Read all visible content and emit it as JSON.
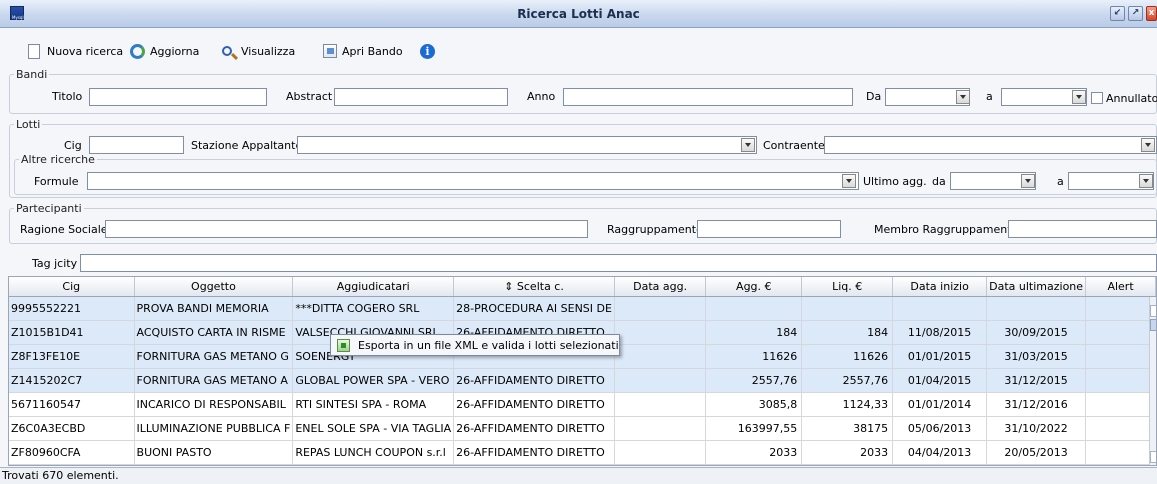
{
  "window": {
    "title": "Ricerca Lotti Anac",
    "icon_label": "Mysql"
  },
  "toolbar": {
    "nuova_ricerca": "Nuova ricerca",
    "aggiorna": "Aggiorna",
    "visualizza": "Visualizza",
    "apri_bando": "Apri Bando"
  },
  "bandi": {
    "legend": "Bandi",
    "titolo_label": "Titolo",
    "abstract_label": "Abstract",
    "anno_label": "Anno",
    "da_label": "Da",
    "a_label": "a",
    "annullato_label": "Annullato"
  },
  "lotti": {
    "legend": "Lotti",
    "cig_label": "Cig",
    "stazione_label": "Stazione Appaltante",
    "contraente_label": "Contraente"
  },
  "altre": {
    "legend": "Altre ricerche",
    "formule_label": "Formule",
    "ultimo_agg_label": "Ultimo agg.",
    "da_label": "da",
    "a_label": "a"
  },
  "partecipanti": {
    "legend": "Partecipanti",
    "ragione_label": "Ragione Sociale",
    "raggruppamento_label": "Raggruppamento",
    "membro_label": "Membro Raggruppamento"
  },
  "tag": {
    "label": "Tag jcity"
  },
  "grid": {
    "columns": [
      "Cig",
      "Oggetto",
      "Aggiudicatari",
      "⇕ Scelta c.",
      "Data agg.",
      "Agg. €",
      "Liq. €",
      "Data inizio",
      "Data ultimazione",
      "Alert"
    ],
    "rows": [
      [
        "9995552221",
        "PROVA BANDI MEMORIA",
        "***DITTA COGERO SRL",
        "28-PROCEDURA AI SENSI DE",
        "",
        "",
        "",
        "",
        "",
        ""
      ],
      [
        "Z1015B1D41",
        "ACQUISTO CARTA IN RISME",
        "VALSECCHI GIOVANNI SRL",
        "26-AFFIDAMENTO DIRETTO",
        "",
        "184",
        "184",
        "11/08/2015",
        "30/09/2015",
        ""
      ],
      [
        "Z8F13FE10E",
        "FORNITURA GAS METANO G",
        "SOENERGY",
        "",
        "",
        "11626",
        "11626",
        "01/01/2015",
        "31/03/2015",
        ""
      ],
      [
        "Z1415202C7",
        "FORNITURA GAS METANO A",
        "GLOBAL POWER SPA - VERO",
        "26-AFFIDAMENTO DIRETTO",
        "",
        "2557,76",
        "2557,76",
        "01/04/2015",
        "31/12/2015",
        ""
      ],
      [
        "5671160547",
        "INCARICO DI RESPONSABIL",
        "RTI SINTESI SPA - ROMA",
        "26-AFFIDAMENTO DIRETTO",
        "",
        "3085,8",
        "1124,33",
        "01/01/2014",
        "31/12/2016",
        ""
      ],
      [
        "Z6C0A3ECBD",
        "ILLUMINAZIONE PUBBLICA F",
        "ENEL SOLE SPA - VIA TAGLIA",
        "26-AFFIDAMENTO DIRETTO",
        "",
        "163997,55",
        "38175",
        "05/06/2013",
        "31/10/2022",
        ""
      ],
      [
        "ZF80960CFA",
        "BUONI PASTO",
        "REPAS LUNCH COUPON s.r.l",
        "26-AFFIDAMENTO DIRETTO",
        "",
        "2033",
        "2033",
        "04/04/2013",
        "20/05/2013",
        ""
      ]
    ]
  },
  "context_menu": {
    "item": "Esporta in un file XML e valida i lotti selezionati"
  },
  "status": {
    "text": "Trovati 670 elementi."
  },
  "colors": {
    "selection": "#dce9f8",
    "title_bg": "#c9d8ee"
  }
}
